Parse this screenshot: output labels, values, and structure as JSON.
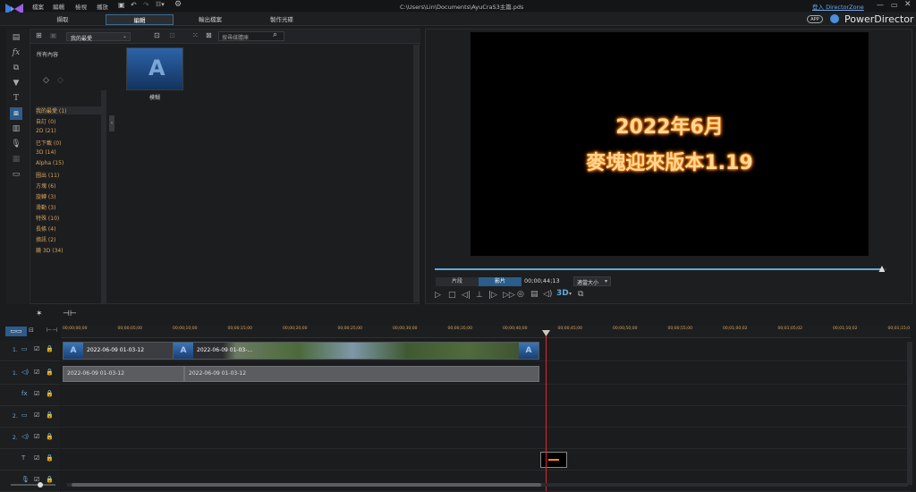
{
  "title_bar": {
    "menu": [
      "檔案",
      "編輯",
      "檢視",
      "播放"
    ],
    "file_path": "C:\\Users\\Lin\\Documents\\AyuCraS3主篇.pds",
    "login_link": "登入 DirectorZone",
    "app_badge": "APP",
    "app_name": "PowerDirector"
  },
  "mode_tabs": [
    {
      "label": "擷取"
    },
    {
      "label": "編輯"
    },
    {
      "label": "輸出檔案"
    },
    {
      "label": "製作光碟"
    }
  ],
  "library": {
    "filter_value": "我的最愛",
    "search_placeholder": "搜尋媒體庫",
    "all_content_label": "所有內容",
    "categories": [
      "我的最愛 (1)",
      "自訂 (0)",
      "2D (21)",
      "已下載 (0)",
      "3D (14)",
      "Alpha (15)",
      "圖出 (11)",
      "方塊 (6)",
      "旋轉 (3)",
      "滑動 (3)",
      "特殊 (10)",
      "長條 (4)",
      "擠訊 (2)",
      "鏡 3D (34)"
    ],
    "item": {
      "thumb_letter": "A",
      "label": "模糊"
    }
  },
  "preview": {
    "line1": "2022年6月",
    "line2": "麥塊迎來版本1.19",
    "scrub_progress": 0.99,
    "clip_tab": "片段",
    "movie_tab": "影片",
    "timecode": "00;00;44;13",
    "size_select": "適當大小",
    "label_3d": "3D"
  },
  "timeline": {
    "ruler": [
      "00;00;00;00",
      "00;00;05;00",
      "00;00;10;00",
      "00;00;15;00",
      "00;00;20;00",
      "00;00;25;00",
      "00;00;30;00",
      "00;00;35;00",
      "00;00;40;00",
      "00;00;45;00",
      "00;00;50;00",
      "00;00;55;00",
      "00;01;00;02",
      "00;01;05;02",
      "00;01;10;02",
      "00;01;15;0"
    ],
    "tracks": [
      {
        "num": "1.",
        "kind": "video"
      },
      {
        "num": "1.",
        "kind": "audio"
      },
      {
        "num": "",
        "kind": "fx"
      },
      {
        "num": "2.",
        "kind": "video"
      },
      {
        "num": "2.",
        "kind": "audio"
      },
      {
        "num": "",
        "kind": "title"
      },
      {
        "num": "",
        "kind": "voice"
      }
    ],
    "video_clip_1": "2022-06-09 01-03-12",
    "video_clip_2": "2022-06-09 01-03-...",
    "audio_clip_1": "2022-06-09 01-03-12",
    "audio_clip_2": "2022-06-09 01-03-12"
  }
}
